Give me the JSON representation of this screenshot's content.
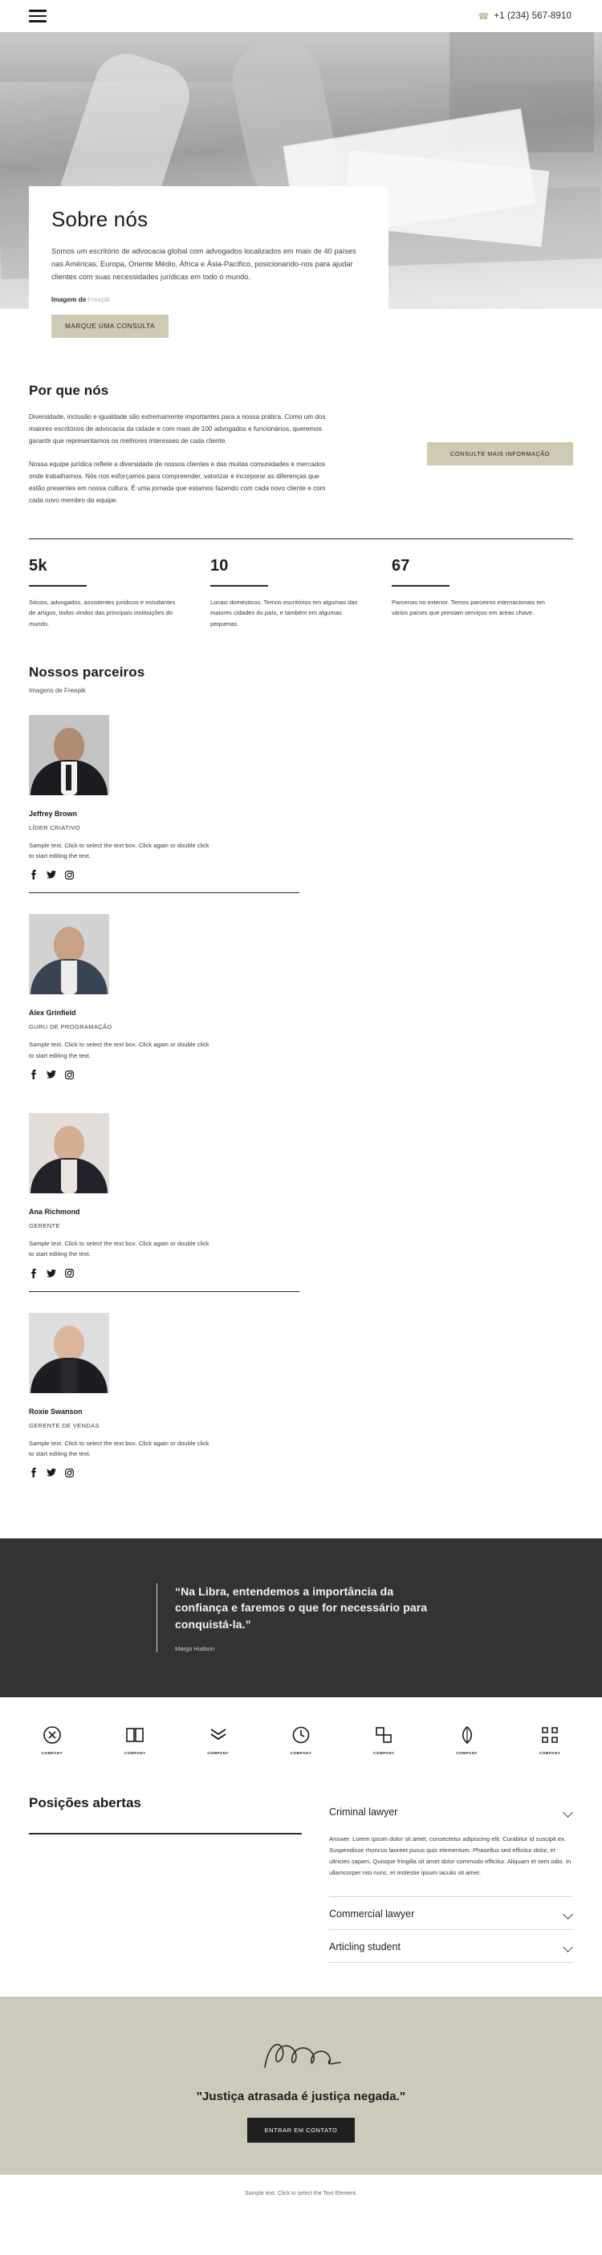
{
  "header": {
    "menu_icon": "hamburger-menu-icon",
    "phone_icon": "phone-icon",
    "phone": "+1 (234) 567-8910"
  },
  "about": {
    "title": "Sobre nós",
    "paragraph": "Somos um escritório de advocacia global com advogados localizados em mais de 40 países nas Américas, Europa, Oriente Médio, África e Ásia-Pacífico, posicionando-nos para ajudar clientes com suas necessidades jurídicas em todo o mundo.",
    "credit_label": "Imagem de ",
    "credit_link": "Freepik",
    "cta": "MARQUE UMA CONSULTA"
  },
  "whyus": {
    "title": "Por que nós",
    "paragraph1": "Diversidade, inclusão e igualdade são extremamente importantes para a nossa prática. Como um dos maiores escritórios de advocacia da cidade e com mais de 100 advogados e funcionários, queremos garantir que representamos os melhores interesses de cada cliente.",
    "paragraph2": "Nossa equipe jurídica reflete a diversidade de nossos clientes e das muitas comunidades e mercados onde trabalhamos. Nós nos esforçamos para compreender, valorizar e incorporar as diferenças que estão presentes em nossa cultura. É uma jornada que estamos fazendo com cada novo cliente e com cada novo membro da equipe.",
    "cta": "CONSULTE MAIS INFORMAÇÃO"
  },
  "stats": [
    {
      "number": "5k",
      "description": "Sócios, advogados, assistentes jurídicos e estudantes de artigos, todos vindos das principais instituições do mundo."
    },
    {
      "number": "10",
      "description": "Locais domésticos. Temos escritórios em algumas das maiores cidades do país, e também em algumas pequenas."
    },
    {
      "number": "67",
      "description": "Parcerias no exterior. Temos parceiros internacionais em vários países que prestam serviços em áreas chave."
    }
  ],
  "partners": {
    "title": "Nossos parceiros",
    "subtitle": "Imagens de Freepik",
    "sample_text": "Sample text. Click to select the text box. Click again or double click to start editing the text.",
    "social_icons": [
      "facebook-icon",
      "twitter-icon",
      "instagram-icon"
    ],
    "members": [
      {
        "name": "Jeffrey Brown",
        "role": "LÍDER CRIATIVO"
      },
      {
        "name": "Ana Richmond",
        "role": "GERENTE"
      },
      {
        "name": "Alex Grinfield",
        "role": "GURU DE PROGRAMAÇÃO"
      },
      {
        "name": "Roxie Swanson",
        "role": "GERENTE DE VENDAS"
      }
    ]
  },
  "quote": {
    "text": "“Na Libra, entendemos a importância da confiança e faremos o que for necessário para conquistá-la.”",
    "author": "Margo Hudson"
  },
  "logos": [
    {
      "name": "COMPANY",
      "mark": "circle-emblem-icon"
    },
    {
      "name": "COMPANY",
      "mark": "book-icon"
    },
    {
      "name": "COMPANY",
      "mark": "chevrons-icon"
    },
    {
      "name": "COMPANY",
      "mark": "clock-icon"
    },
    {
      "name": "COMPANY",
      "mark": "squares-icon"
    },
    {
      "name": "COMPANY",
      "mark": "leaf-icon"
    },
    {
      "name": "COMPANY",
      "mark": "brackets-icon"
    }
  ],
  "positions": {
    "title": "Posições abertas",
    "items": [
      {
        "title": "Criminal lawyer",
        "body": "Answer. Lorem ipsum dolor sit amet, consectetur adipiscing elit. Curabitur id suscipit ex. Suspendisse rhoncus laoreet purus quis elementum. Phasellus sed efficitur dolor, et ultricies sapien. Quisque fringilla sit amet dolor commodo efficitur. Aliquam et sem odio. In ullamcorper nisi nunc, et molestie ipsum iaculis sit amet.",
        "open": true
      },
      {
        "title": "Commercial lawyer",
        "body": "",
        "open": false
      },
      {
        "title": "Articling student",
        "body": "",
        "open": false
      }
    ]
  },
  "cta_footer": {
    "signature_icon": "handwritten-signature-icon",
    "heading": "\"Justiça atrasada é justiça negada.\"",
    "button": "ENTRAR EM CONTATO"
  },
  "footnote": "Sample text. Click to select the Text Element.",
  "colors": {
    "beige_button": "#cfcab3",
    "dark_section": "#333333",
    "cta_background": "#cccabb",
    "link_blue_grey": "#a9b4bd",
    "text": "#2b2b2b"
  }
}
